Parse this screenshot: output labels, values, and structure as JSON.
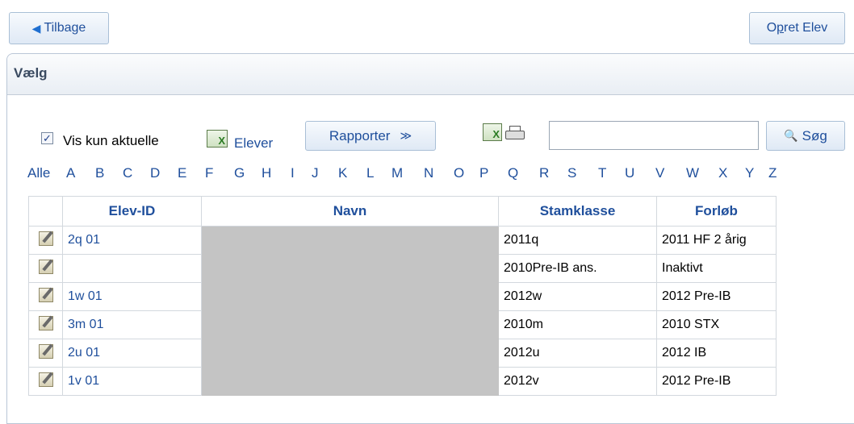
{
  "toolbar": {
    "back_label": "Tilbage",
    "create_label_prefix": "O",
    "create_label_underlined": "p",
    "create_label_suffix": "ret Elev"
  },
  "panel": {
    "title": "Vælg"
  },
  "filters": {
    "checkbox_checked": true,
    "checkbox_mark": "✓",
    "checkbox_label": "Vis kun aktuelle",
    "elever_label": "Elever",
    "rapporter_label": "Rapporter",
    "rapporter_chevron": "≫",
    "search_placeholder": "",
    "search_value": "",
    "search_label": "Søg"
  },
  "alphabet": [
    "Alle",
    "A",
    "B",
    "C",
    "D",
    "E",
    "F",
    "G",
    "H",
    "I",
    "J",
    "K",
    "L",
    "M",
    "N",
    "O",
    "P",
    "Q",
    "R",
    "S",
    "T",
    "U",
    "V",
    "W",
    "X",
    "Y",
    "Z"
  ],
  "table": {
    "headers": [
      "",
      "Elev-ID",
      "Navn",
      "Stamklasse",
      "Forløb"
    ],
    "rows": [
      {
        "id": "2q 01",
        "name": "",
        "stamklasse": "2011q",
        "forlob": "2011 HF 2 årig"
      },
      {
        "id": "",
        "name": "",
        "stamklasse": "2010Pre-IB ans.",
        "forlob": "Inaktivt"
      },
      {
        "id": "1w 01",
        "name": "",
        "stamklasse": "2012w",
        "forlob": "2012 Pre-IB"
      },
      {
        "id": "3m 01",
        "name": "",
        "stamklasse": "2010m",
        "forlob": "2010 STX"
      },
      {
        "id": "2u 01",
        "name": "",
        "stamklasse": "2012u",
        "forlob": "2012 IB"
      },
      {
        "id": "1v 01",
        "name": "",
        "stamklasse": "2012v",
        "forlob": "2012 Pre-IB"
      }
    ]
  },
  "icons": {
    "back": "arrow-left-icon",
    "excel": "excel-icon",
    "print": "printer-icon",
    "search": "magnifier-icon",
    "edit": "edit-icon"
  }
}
